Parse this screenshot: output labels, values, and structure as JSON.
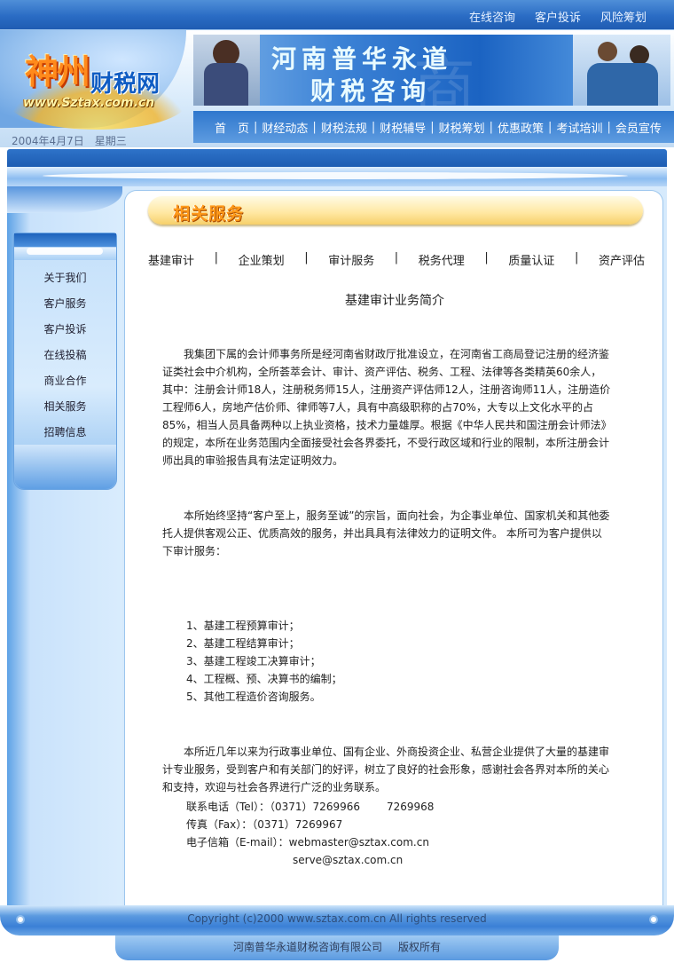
{
  "top_links": [
    "在线咨询",
    "客户投诉",
    "风险筹划"
  ],
  "logo": {
    "name_cn_part1": "神州",
    "name_cn_part2": "财税网",
    "url": "www.Sztax.com.cn"
  },
  "banner": {
    "line1": "河南普华永道",
    "line2": "财税咨询",
    "watermark": "商"
  },
  "nav": [
    "首　页",
    "财经动态",
    "财税法规",
    "财税辅导",
    "财税筹划",
    "优惠政策",
    "考试培训",
    "会员宣传"
  ],
  "date": "2004年4月7日　星期三",
  "sidebar": {
    "items": [
      "关于我们",
      "客户服务",
      "客户投诉",
      "在线投稿",
      "商业合作",
      "相关服务",
      "招聘信息"
    ]
  },
  "section_title": "相关服务",
  "tabs": [
    "基建审计",
    "企业策划",
    "审计服务",
    "税务代理",
    "质量认证",
    "资产评估"
  ],
  "article": {
    "heading": "基建审计业务简介",
    "p1": "我集团下属的会计师事务所是经河南省财政厅批准设立，在河南省工商局登记注册的经济鉴证类社会中介机构，全所荟萃会计、审计、资产评估、税务、工程、法律等各类精英60余人，其中：注册会计师18人，注册税务师15人，注册资产评估师12人，注册咨询师11人，注册造价工程师6人，房地产估价师、律师等7人，具有中高级职称的占70%，大专以上文化水平的占85%，相当人员具备两种以上执业资格，技术力量雄厚。根据《中华人民共和国注册会计师法》的规定，本所在业务范围内全面接受社会各界委托，不受行政区域和行业的限制，本所注册会计师出具的审验报告具有法定证明效力。",
    "p2": "本所始终坚持“客户至上，服务至诚”的宗旨，面向社会，为企事业单位、国家机关和其他委托人提供客观公正、优质高效的服务，并出具具有法律效力的证明文件。 本所可为客户提供以下审计服务：",
    "list": [
      "1、基建工程预算审计；",
      "2、基建工程结算审计；",
      "3、基建工程竣工决算审计；",
      "4、工程概、预、决算书的编制；",
      "5、其他工程造价咨询服务。"
    ],
    "p3": "本所近几年以来为行政事业单位、国有企业、外商投资企业、私营企业提供了大量的基建审计专业服务，受到客户和有关部门的好评，树立了良好的社会形象，感谢社会各界对本所的关心和支持，欢迎与社会各界进行广泛的业务联系。",
    "contact": {
      "tel_label": "联系电话（Tel）：（0371）7269966",
      "tel_extra": "7269968",
      "fax": "传真（Fax）：（0371）7269967",
      "email_label": "电子信箱（E-mail）：webmaster@sztax.com.cn",
      "email2": "serve@sztax.com.cn"
    }
  },
  "footer": {
    "copyright": "Copyright (c)2000 www.sztax.com.cn All rights reserved",
    "company": "河南普华永道财税咨询有限公司",
    "rights": "版权所有"
  }
}
